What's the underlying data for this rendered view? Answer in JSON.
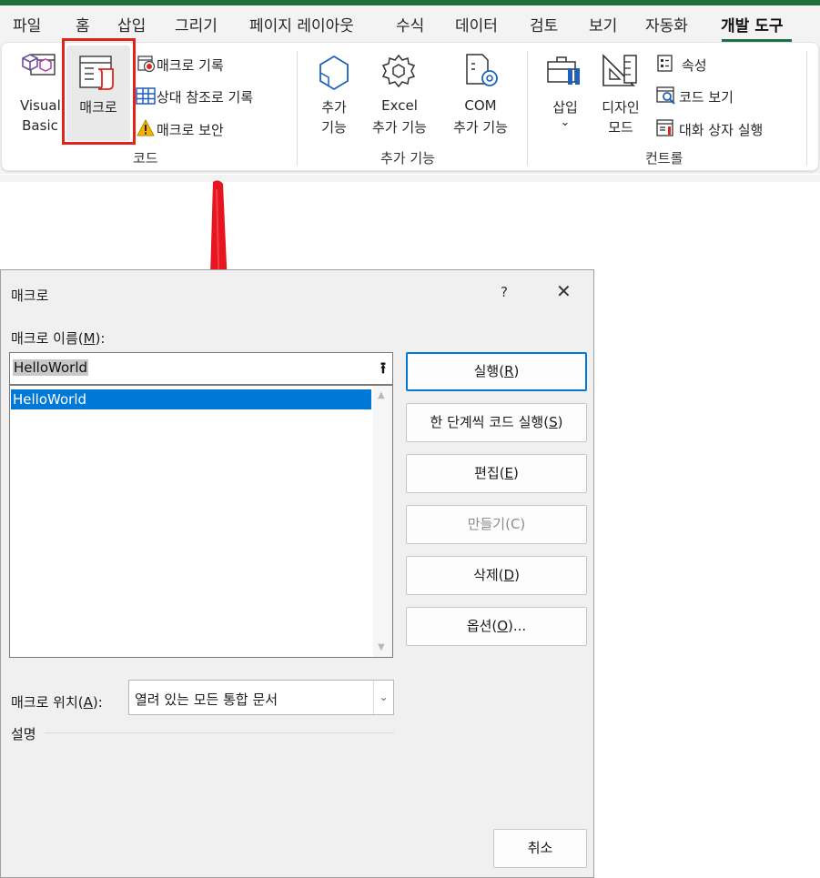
{
  "ribbon": {
    "tabs": [
      "파일",
      "홈",
      "삽입",
      "그리기",
      "페이지 레이아웃",
      "수식",
      "데이터",
      "검토",
      "보기",
      "자동화",
      "개발 도구"
    ],
    "active_tab": "개발 도구",
    "code_group": {
      "label": "코드",
      "visual_basic": [
        "Visual",
        "Basic"
      ],
      "macros": "매크로",
      "record_macro": "매크로 기록",
      "relative_ref": "상대 참조로 기록",
      "macro_security": "매크로 보안"
    },
    "addins_group": {
      "label": "추가 기능",
      "addins": [
        "추가",
        "기능"
      ],
      "excel_addins": [
        "Excel",
        "추가 기능"
      ],
      "com_addins": [
        "COM",
        "추가 기능"
      ]
    },
    "controls_group": {
      "label": "컨트롤",
      "insert": "삽입",
      "insert_chevron": "⌄",
      "design_mode": [
        "디자인",
        "모드"
      ],
      "properties": "속성",
      "view_code": "코드 보기",
      "run_dialog": "대화 상자 실행"
    },
    "highlight_color": "#e2231a"
  },
  "dialog": {
    "title": "매크로",
    "help": "?",
    "close": "✕",
    "name_label": {
      "pre": "매크로 이름(",
      "key": "M",
      "post": "):"
    },
    "name_value": "HelloWorld",
    "macro_list": [
      "HelloWorld"
    ],
    "buttons": {
      "run": {
        "pre": "실행(",
        "key": "R",
        "post": ")"
      },
      "step_into": {
        "pre": "한 단계씩 코드 실행(",
        "key": "S",
        "post": ")"
      },
      "edit": {
        "pre": "편집(",
        "key": "E",
        "post": ")"
      },
      "create": "만들기(C)",
      "delete": {
        "pre": "삭제(",
        "key": "D",
        "post": ")"
      },
      "options": {
        "pre": "옵션(",
        "key": "O",
        "post": ")..."
      },
      "cancel": "취소"
    },
    "location_label": {
      "pre": "매크로 위치(",
      "key": "A",
      "post": "):"
    },
    "location_value": "열려 있는 모든 통합 문서",
    "description_label": "설명"
  }
}
